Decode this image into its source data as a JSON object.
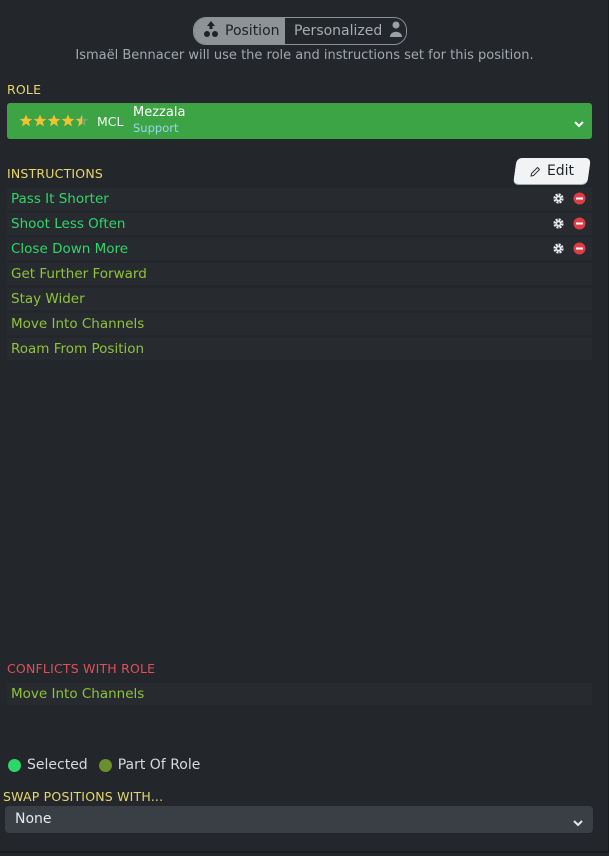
{
  "toggle": {
    "position_label": "Position",
    "personalized_label": "Personalized"
  },
  "subtitle": "Ismaël Bennacer will use the role and instructions set for this position.",
  "role_section": {
    "label": "ROLE",
    "star_rating": 4.5,
    "position_code": "MCL",
    "role_name": "Mezzala",
    "duty": "Support"
  },
  "instructions_section": {
    "label": "INSTRUCTIONS",
    "edit_label": "Edit",
    "items": [
      {
        "label": "Pass It Shorter",
        "state": "selected"
      },
      {
        "label": "Shoot Less Often",
        "state": "selected"
      },
      {
        "label": "Close Down More",
        "state": "selected"
      },
      {
        "label": "Get Further Forward",
        "state": "part-of-role"
      },
      {
        "label": "Stay Wider",
        "state": "part-of-role"
      },
      {
        "label": "Move Into Channels",
        "state": "part-of-role"
      },
      {
        "label": "Roam From Position",
        "state": "part-of-role"
      }
    ]
  },
  "conflicts_section": {
    "label": "CONFLICTS WITH ROLE",
    "items": [
      {
        "label": "Move Into Channels"
      }
    ]
  },
  "legend": {
    "selected_label": "Selected",
    "part_of_role_label": "Part Of Role"
  },
  "swap_section": {
    "label": "SWAP POSITIONS WITH...",
    "value": "None"
  },
  "colors": {
    "selected": "#2fd66a",
    "part_of_role": "#8fc33a",
    "role_bar": "#3da446",
    "section_label": "#e9d66a",
    "conflict_label": "#e04f5a",
    "remove": "#e03c45"
  },
  "icons": [
    "position-icon",
    "person-icon",
    "star-icon",
    "chevron-down-icon",
    "pencil-icon",
    "gear-icon",
    "remove-icon"
  ]
}
